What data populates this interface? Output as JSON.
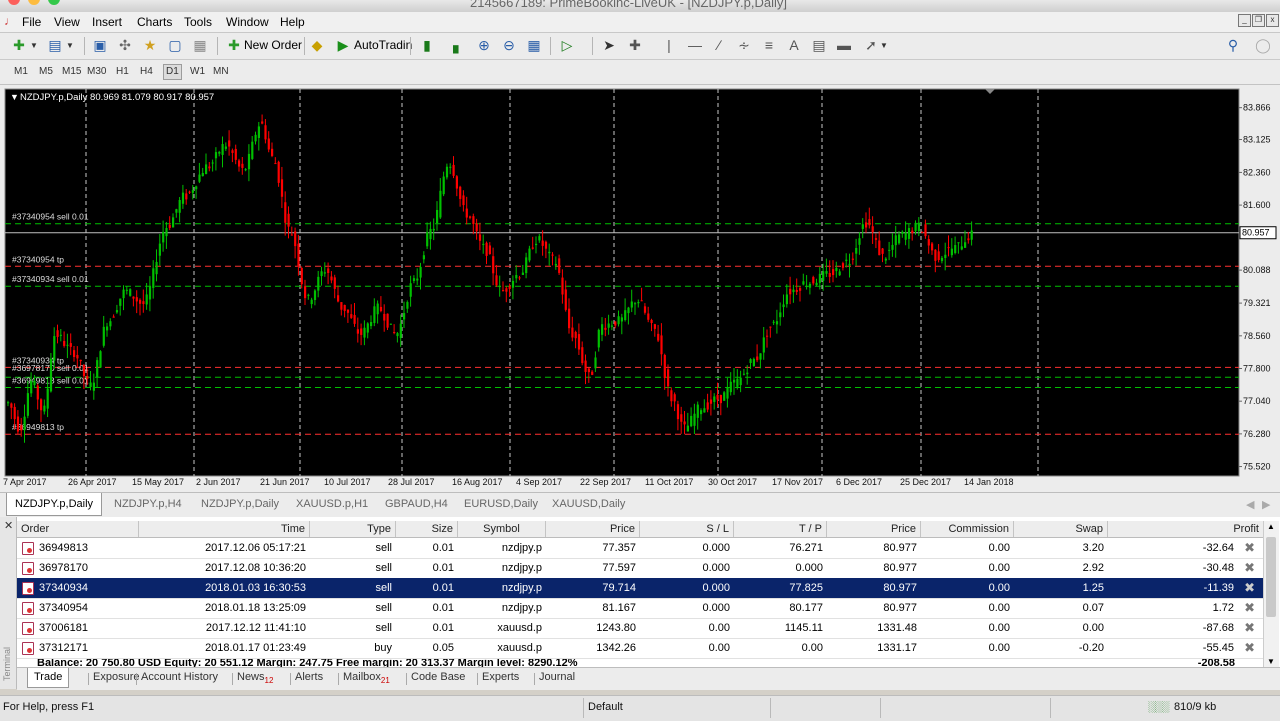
{
  "window": {
    "title": "2145667189: PrimeBookinc-LiveUK - [NZDJPY.p,Daily]"
  },
  "menu": [
    "File",
    "View",
    "Insert",
    "Charts",
    "Tools",
    "Window",
    "Help"
  ],
  "toolbar": {
    "new_order": "New Order",
    "autotrading": "AutoTradin"
  },
  "timeframes": [
    "M1",
    "M5",
    "M15",
    "M30",
    "H1",
    "H4",
    "D1",
    "W1",
    "MN"
  ],
  "timeframe_active": "D1",
  "chart": {
    "info": "NZDJPY.p,Daily  80.969 81.079 80.917 80.957",
    "price_labels": [
      "83.866",
      "83.125",
      "82.360",
      "81.600",
      "80.957",
      "80.088",
      "79.321",
      "78.560",
      "77.800",
      "77.040",
      "76.280",
      "75.520"
    ],
    "current_price": "80.957",
    "date_labels": [
      "7 Apr 2017",
      "26 Apr 2017",
      "15 May 2017",
      "2 Jun 2017",
      "21 Jun 2017",
      "10 Jul 2017",
      "28 Jul 2017",
      "16 Aug 2017",
      "4 Sep 2017",
      "22 Sep 2017",
      "11 Oct 2017",
      "30 Oct 2017",
      "17 Nov 2017",
      "6 Dec 2017",
      "25 Dec 2017",
      "14 Jan 2018"
    ],
    "level_labels": [
      "#37340954 sell 0.01",
      "#37340954 tp",
      "#37340934 sell 0.01",
      "#37340934 tp",
      "#36978170 sell 0.01",
      "#36949813 sell 0.01",
      "#36949813 tp"
    ],
    "colors": {
      "bull": "#00c000",
      "bear": "#ff0000",
      "background": "#000000",
      "grid": "#c8c8c8"
    }
  },
  "chart_tabs": [
    "NZDJPY.p,Daily",
    "NZDJPY.p,H4",
    "NZDJPY.p,Daily",
    "XAUUSD.p,H1",
    "GBPAUD,H4",
    "EURUSD,Daily",
    "XAUUSD,Daily"
  ],
  "table": {
    "columns": [
      "Order",
      "Time",
      "Type",
      "Size",
      "Symbol",
      "Price",
      "S / L",
      "T / P",
      "Price",
      "Commission",
      "Swap",
      "Profit"
    ],
    "rows": [
      [
        "36949813",
        "2017.12.06 05:17:21",
        "sell",
        "0.01",
        "nzdjpy.p",
        "77.357",
        "0.000",
        "76.271",
        "80.977",
        "0.00",
        "3.20",
        "-32.64"
      ],
      [
        "36978170",
        "2017.12.08 10:36:20",
        "sell",
        "0.01",
        "nzdjpy.p",
        "77.597",
        "0.000",
        "0.000",
        "80.977",
        "0.00",
        "2.92",
        "-30.48"
      ],
      [
        "37340934",
        "2018.01.03 16:30:53",
        "sell",
        "0.01",
        "nzdjpy.p",
        "79.714",
        "0.000",
        "77.825",
        "80.977",
        "0.00",
        "1.25",
        "-11.39"
      ],
      [
        "37340954",
        "2018.01.18 13:25:09",
        "sell",
        "0.01",
        "nzdjpy.p",
        "81.167",
        "0.000",
        "80.177",
        "80.977",
        "0.00",
        "0.07",
        "1.72"
      ],
      [
        "37006181",
        "2017.12.12 11:41:10",
        "sell",
        "0.01",
        "xauusd.p",
        "1243.80",
        "0.00",
        "1145.11",
        "1331.48",
        "0.00",
        "0.00",
        "-87.68"
      ],
      [
        "37312171",
        "2018.01.17 01:23:49",
        "buy",
        "0.05",
        "xauusd.p",
        "1342.26",
        "0.00",
        "0.00",
        "1331.17",
        "0.00",
        "-0.20",
        "-55.45"
      ]
    ],
    "selected_row": 2,
    "balance_text": "Balance: 20 750.80 USD  Equity: 20 551.12  Margin: 247.75  Free margin: 20 313.37  Margin level: 8290.12%",
    "total_profit": "-208.58"
  },
  "terminal_label": "Terminal",
  "terminal_tabs": [
    {
      "label": "Trade",
      "badge": ""
    },
    {
      "label": "Exposure",
      "badge": ""
    },
    {
      "label": "Account History",
      "badge": ""
    },
    {
      "label": "News",
      "badge": "12"
    },
    {
      "label": "Alerts",
      "badge": ""
    },
    {
      "label": "Mailbox",
      "badge": "21"
    },
    {
      "label": "Code Base",
      "badge": ""
    },
    {
      "label": "Experts",
      "badge": ""
    },
    {
      "label": "Journal",
      "badge": ""
    }
  ],
  "status": {
    "help": "For Help, press F1",
    "profile": "Default",
    "traffic": "810/9 kb"
  }
}
